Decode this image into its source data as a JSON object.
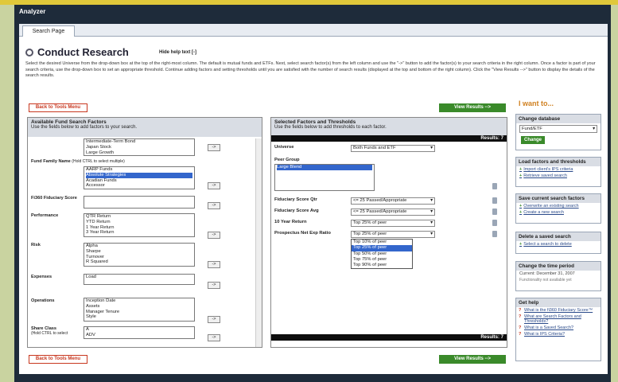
{
  "app": {
    "title": "Analyzer"
  },
  "tabs": [
    {
      "label": "Search Page"
    }
  ],
  "heading": {
    "title": "Conduct Research",
    "hide_help": "Hide help text [-]"
  },
  "help_text": "Select the desired Universe from the drop-down box at the top of the right-most column. The default is mutual funds and ETFs. Next, select search factor(s) from the left column and use the \"->\" button to add the factor(s) to your search criteria in the right column. Once a factor is part of your search criteria, use the drop-down box to set an appropriate threshold. Continue adding factors and setting thresholds until you are satisfied with the number of search results (displayed at the top and bottom of the right column). Click the \"View Results -->\" button to display the details of the search results.",
  "buttons": {
    "back": "Back to Tools Menu",
    "view_results": "View Results -->",
    "add": "->",
    "change": "Change"
  },
  "available": {
    "title": "Available Fund Search Factors",
    "subtitle": "Use the fields below to add factors to your search.",
    "factors": [
      {
        "label": "",
        "hint": "",
        "options": [
          "Intermediate-Term Bond",
          "Japan Stock",
          "Large Growth"
        ]
      },
      {
        "label": "Fund Family Name",
        "hint": "(Hold CTRL to select multiple)",
        "options": [
          "AARP Funds",
          "Absolute Strategies",
          "Acadian Funds",
          "Accessor"
        ]
      },
      {
        "label": "Fi360 Fiduciary Score",
        "hint": "",
        "options": []
      },
      {
        "label": "Performance",
        "hint": "",
        "options": [
          "QTR Return",
          "YTD Return",
          "1 Year Return",
          "3 Year Return"
        ]
      },
      {
        "label": "Risk",
        "hint": "",
        "options": [
          "Alpha",
          "Sharpe",
          "Turnover",
          "R Squared"
        ]
      },
      {
        "label": "Expenses",
        "hint": "",
        "options": [
          "Load"
        ]
      },
      {
        "label": "Operations",
        "hint": "",
        "options": [
          "Inception Date",
          "Assets",
          "Manager Tenure",
          "Style"
        ]
      },
      {
        "label": "Share Class",
        "hint": "(Hold CTRL to select",
        "options": [
          "A",
          "ADV"
        ]
      }
    ]
  },
  "selected": {
    "title": "Selected Factors and Thresholds",
    "subtitle": "Use the fields below to add thresholds to each factor.",
    "results": "Results: 7",
    "universe": {
      "label": "Universe",
      "value": "Both Funds and ETF"
    },
    "peer_group": {
      "label": "Peer Group",
      "options": [
        "Large Blend"
      ]
    },
    "rows": [
      {
        "label": "Fiduciary Score Qtr",
        "value": "<= 25 Passed/Appropriate"
      },
      {
        "label": "Fiduciary Score Avg",
        "value": "<= 25 Passed/Appropriate"
      },
      {
        "label": "10 Year Return",
        "value": "Top 25% of peer"
      },
      {
        "label": "Prospectus Net Exp Ratio",
        "value": "Top 25% of peer"
      }
    ],
    "dropdown_options": [
      "Top 10% of peer",
      "Top 25% of peer",
      "Top 50% of peer",
      "Top 75% of peer",
      "Top 90% of peer"
    ]
  },
  "right": {
    "iwant": "I want to...",
    "change_db": {
      "title": "Change database",
      "value": "Fund/ETF"
    },
    "load": {
      "title": "Load factors and thresholds",
      "links": [
        "Import client's IPS criteria",
        "Retrieve saved search"
      ]
    },
    "save": {
      "title": "Save current search factors",
      "links": [
        "Overwrite an existing search",
        "Create a new search"
      ]
    },
    "delete": {
      "title": "Delete a saved search",
      "links": [
        "Select a search to delete"
      ]
    },
    "period": {
      "title": "Change the time period",
      "current": "Current: December 31, 2007",
      "note": "Functionality not available yet"
    },
    "help": {
      "title": "Get help",
      "links": [
        "What is the fi360 Fiduciary Score™",
        "What are Search Factors and Thresholds?",
        "What is a Saved Search?",
        "What is IPS Criteria?"
      ]
    }
  }
}
